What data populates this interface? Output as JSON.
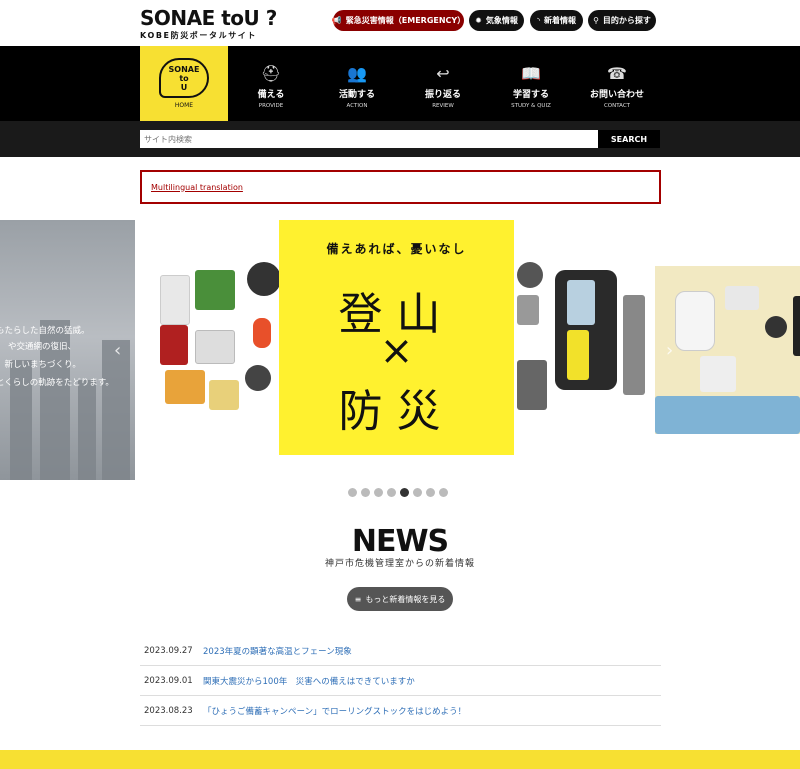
{
  "header": {
    "logo_main": "SONAE toU ?",
    "logo_sub": "KOBE防災ポータルサイト",
    "buttons": [
      {
        "label": "緊急災害情報（EMERGENCY）",
        "icon": "megaphone-icon"
      },
      {
        "label": "気象情報",
        "icon": "sun-icon"
      },
      {
        "label": "新着情報",
        "icon": "rss-icon"
      },
      {
        "label": "目的から探す",
        "icon": "search-icon"
      }
    ]
  },
  "nav": {
    "home": {
      "badge_top": "SONAE",
      "badge_mid": "to",
      "badge_bot": "U",
      "label": "HOME"
    },
    "items": [
      {
        "jp": "備える",
        "en": "PROVIDE",
        "icon": "helmet-icon"
      },
      {
        "jp": "活動する",
        "en": "ACTION",
        "icon": "people-icon"
      },
      {
        "jp": "振り返る",
        "en": "REVIEW",
        "icon": "return-arrow-icon"
      },
      {
        "jp": "学習する",
        "en": "STUDY & QUIZ",
        "icon": "book-icon"
      },
      {
        "jp": "お問い合わせ",
        "en": "CONTACT",
        "icon": "phone-icon"
      }
    ]
  },
  "search": {
    "placeholder": "サイト内検索",
    "button": "SEARCH"
  },
  "multilingual": {
    "link": "Multilingual translation"
  },
  "slider": {
    "left_lines": [
      "もたらした自然の猛威。",
      "や交通網の復旧、",
      "、新しいまちづくり。",
      "とくらしの軌跡をたどります。"
    ],
    "poster": {
      "tagline": "備えあれば、憂いなし",
      "line1": "登山",
      "cross": "×",
      "line2": "防災"
    },
    "dots_total": 8,
    "dots_active": 5
  },
  "news": {
    "title": "NEWS",
    "subtitle": "神戸市危機管理室からの新着情報",
    "more_button": "もっと新着情報を見る",
    "items": [
      {
        "date": "2023.09.27",
        "title": "2023年夏の顕著な高温とフェーン現象"
      },
      {
        "date": "2023.09.01",
        "title": "関東大震災から100年　災害への備えはできていますか"
      },
      {
        "date": "2023.08.23",
        "title": "「ひょうご備蓄キャンペーン」でローリングストックをはじめよう！"
      }
    ]
  },
  "colors": {
    "accent_yellow": "#f7e032",
    "emergency_red": "#8a0000",
    "link_blue": "#2f6fb7"
  }
}
